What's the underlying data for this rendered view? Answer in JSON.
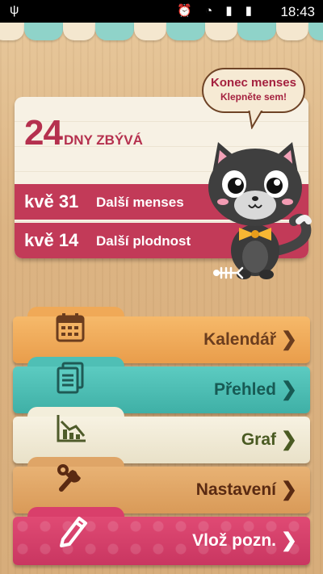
{
  "status_bar": {
    "time": "18:43"
  },
  "card": {
    "days_number": "24",
    "days_label": "DNY ZBÝVÁ",
    "rows": [
      {
        "date": "kvě 31",
        "label": "Další menses"
      },
      {
        "date": "kvě 14",
        "label": "Další plodnost"
      }
    ]
  },
  "bubble": {
    "title": "Konec menses",
    "subtitle": "Klepněte sem!"
  },
  "menu": {
    "calendar": {
      "label": "Kalendář",
      "icon": "calendar-icon"
    },
    "overview": {
      "label": "Přehled",
      "icon": "list-icon"
    },
    "graph": {
      "label": "Graf",
      "icon": "chart-icon"
    },
    "settings": {
      "label": "Nastavení",
      "icon": "wrench-icon"
    },
    "note": {
      "label": "Vlož pozn.",
      "icon": "pencil-icon"
    },
    "chevron": "❯"
  },
  "colors": {
    "accent": "#c23a58",
    "calendar": "#f0a957",
    "overview": "#4fbfb5",
    "graph": "#f3eedb",
    "settings": "#dfa567",
    "note": "#d93f6b"
  }
}
